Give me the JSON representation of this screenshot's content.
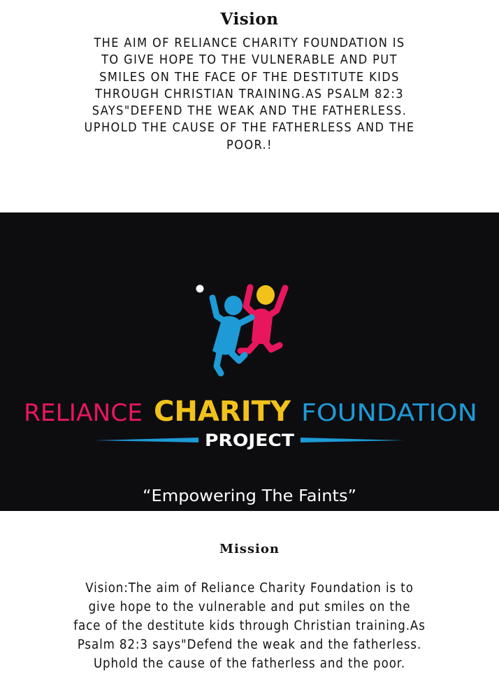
{
  "vision": {
    "title": "Vision",
    "text": "THE AIM OF RELIANCE CHARITY FOUNDATION IS TO GIVE HOPE TO THE VULNERABLE AND PUT SMILES ON THE FACE OF THE DESTITUTE KIDS THROUGH CHRISTIAN TRAINING.AS PSALM 82:3 SAYS\"DEFEND THE WEAK AND THE FATHERLESS. UPHOLD THE CAUSE OF THE FATHERLESS AND THE POOR.!"
  },
  "banner": {
    "logo_word_1": "RELIANCE",
    "logo_word_2": "CHARITY",
    "logo_word_3": "FOUNDATION",
    "logo_subtitle": "PROJECT",
    "tagline": "“Empowering The Faints”",
    "colors": {
      "background": "#0d0d10",
      "pink": "#e8175d",
      "yellow": "#f2c21a",
      "blue": "#1e9ad6",
      "white": "#ffffff"
    },
    "icon": "two-children-jumping-icon"
  },
  "mission": {
    "title": "Mission",
    "text": "Vision:The aim of Reliance Charity Foundation is to give hope to the vulnerable and put smiles on the face of the destitute kids through Christian training.As Psalm 82:3 says\"Defend the weak and the fatherless. Uphold the cause of the fatherless and the poor."
  }
}
